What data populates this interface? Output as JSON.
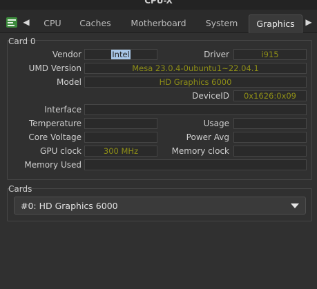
{
  "window": {
    "title": "CPU-X"
  },
  "tabs": [
    {
      "label": "CPU"
    },
    {
      "label": "Caches"
    },
    {
      "label": "Motherboard"
    },
    {
      "label": "System"
    },
    {
      "label": "Graphics",
      "active": true
    }
  ],
  "card": {
    "group_title": "Card 0",
    "vendor": {
      "label": "Vendor",
      "value": "Intel",
      "selected": true
    },
    "driver": {
      "label": "Driver",
      "value": "i915"
    },
    "umd_version": {
      "label": "UMD Version",
      "value": "Mesa 23.0.4-0ubuntu1~22.04.1"
    },
    "model": {
      "label": "Model",
      "value": "HD Graphics 6000"
    },
    "device_id": {
      "label": "DeviceID",
      "value": "0x1626:0x09"
    },
    "interface": {
      "label": "Interface",
      "value": ""
    },
    "temperature": {
      "label": "Temperature",
      "value": ""
    },
    "usage": {
      "label": "Usage",
      "value": ""
    },
    "core_voltage": {
      "label": "Core Voltage",
      "value": ""
    },
    "power_avg": {
      "label": "Power Avg",
      "value": ""
    },
    "gpu_clock": {
      "label": "GPU clock",
      "value": "300 MHz"
    },
    "memory_clock": {
      "label": "Memory clock",
      "value": ""
    },
    "memory_used": {
      "label": "Memory Used",
      "value": ""
    }
  },
  "cards": {
    "group_title": "Cards",
    "selected": "#0: HD Graphics 6000"
  },
  "colors": {
    "value_text": "#8f8f17",
    "selection": "#a9c7e8",
    "background": "#303030"
  },
  "icons": {
    "app": "cpu-x-app-icon",
    "nav_left": "left-triangle",
    "nav_right": "right-triangle",
    "dropdown": "down-triangle"
  }
}
